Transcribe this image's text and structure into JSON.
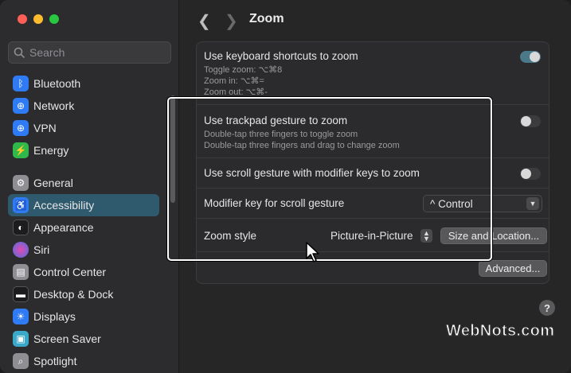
{
  "window": {
    "title": "Zoom"
  },
  "search": {
    "placeholder": "Search"
  },
  "sidebar": {
    "items": [
      {
        "label": "Bluetooth",
        "icon": "bluetooth-icon",
        "color": "#2f7bf6",
        "glyph": "ᛒ"
      },
      {
        "label": "Network",
        "icon": "globe-icon",
        "color": "#2f7bf6",
        "glyph": "⊕"
      },
      {
        "label": "VPN",
        "icon": "vpn-globe-icon",
        "color": "#2f7bf6",
        "glyph": "⊕"
      },
      {
        "label": "Energy",
        "icon": "battery-icon",
        "color": "#2fb94b",
        "glyph": "⚡"
      },
      {
        "label": "General",
        "icon": "gear-icon",
        "color": "#8e8e93",
        "glyph": "⚙"
      },
      {
        "label": "Accessibility",
        "icon": "accessibility-icon",
        "color": "#2f7bf6",
        "glyph": "♿",
        "active": true
      },
      {
        "label": "Appearance",
        "icon": "appearance-icon",
        "color": "#1c1c1e",
        "glyph": "◐"
      },
      {
        "label": "Siri",
        "icon": "siri-icon",
        "color": "#b65bd9",
        "glyph": "●"
      },
      {
        "label": "Control Center",
        "icon": "control-center-icon",
        "color": "#8e8e93",
        "glyph": "▤"
      },
      {
        "label": "Desktop & Dock",
        "icon": "dock-icon",
        "color": "#1c1c1e",
        "glyph": "▬"
      },
      {
        "label": "Displays",
        "icon": "displays-icon",
        "color": "#2f7bf6",
        "glyph": "☀"
      },
      {
        "label": "Screen Saver",
        "icon": "screen-saver-icon",
        "color": "#3aa8c8",
        "glyph": "▣"
      },
      {
        "label": "Spotlight",
        "icon": "spotlight-icon",
        "color": "#8e8e93",
        "glyph": "⌕"
      }
    ]
  },
  "settings": {
    "keyboard": {
      "label": "Use keyboard shortcuts to zoom",
      "toggle_zoom": "Toggle zoom: ⌥⌘8",
      "zoom_in": "Zoom in: ⌥⌘=",
      "zoom_out": "Zoom out: ⌥⌘-",
      "enabled": true
    },
    "trackpad": {
      "label": "Use trackpad gesture to zoom",
      "line1": "Double-tap three fingers to toggle zoom",
      "line2": "Double-tap three fingers and drag to change zoom",
      "enabled": false
    },
    "scroll": {
      "label": "Use scroll gesture with modifier keys to zoom",
      "enabled": false
    },
    "modifier": {
      "label": "Modifier key for scroll gesture",
      "value": "^ Control"
    },
    "zoom_style": {
      "label": "Zoom style",
      "value": "Picture-in-Picture",
      "button": "Size and Location..."
    },
    "advanced_button": "Advanced..."
  },
  "help": "?",
  "watermark": "WebNots.com",
  "colors": {
    "accent": "#2f5a6e",
    "toggle_on": "#4a7a8a"
  }
}
